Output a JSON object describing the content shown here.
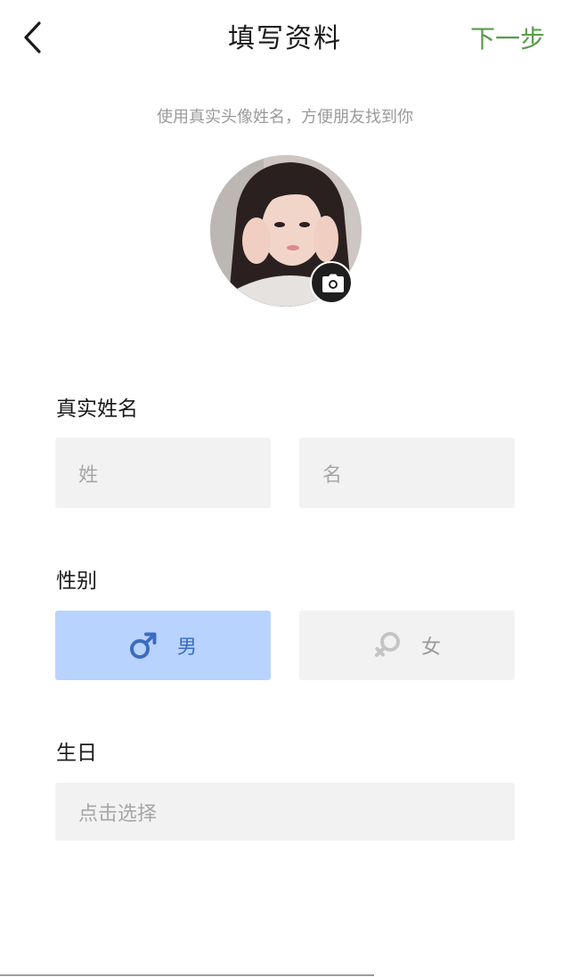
{
  "header": {
    "title": "填写资料",
    "next_label": "下一步"
  },
  "hint": "使用真实头像姓名，方便朋友找到你",
  "name_section": {
    "label": "真实姓名",
    "last_name_placeholder": "姓",
    "first_name_placeholder": "名"
  },
  "gender_section": {
    "label": "性别",
    "male_label": "男",
    "female_label": "女",
    "selected": "男"
  },
  "birthday_section": {
    "label": "生日",
    "placeholder": "点击选择"
  },
  "colors": {
    "accent_green": "#5a9a4c",
    "selected_blue": "#b9d3ff",
    "selected_text": "#3c6cc0",
    "field_bg": "#f2f2f2"
  }
}
